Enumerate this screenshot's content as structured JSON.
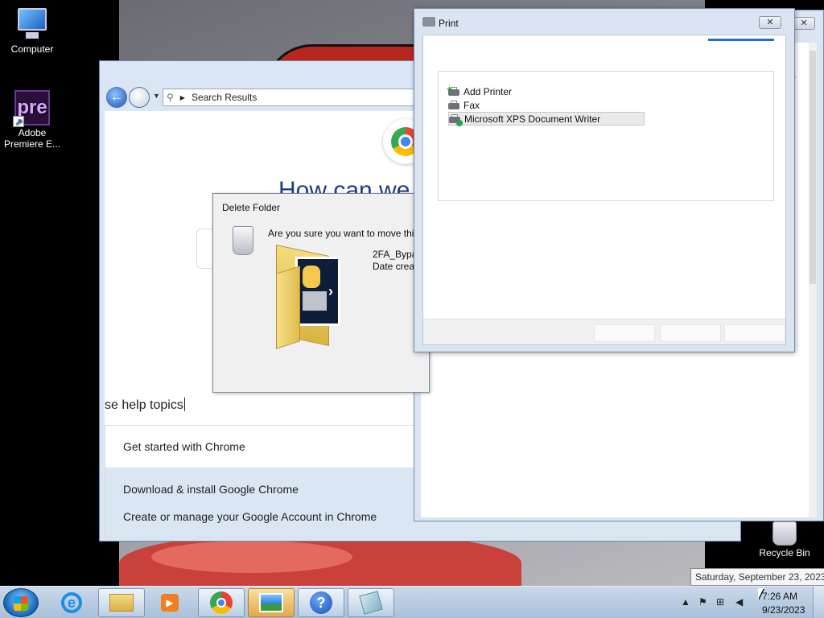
{
  "desktop": {
    "icons": [
      {
        "label": "Computer"
      },
      {
        "label": "Adobe Premiere E..."
      },
      {
        "label": "Recycle Bin"
      }
    ]
  },
  "help_window": {
    "address": "Search Results",
    "heading": "How can we",
    "search_text": "se help topics",
    "topic_header": "Get started with Chrome",
    "topics": [
      "Download & install Google Chrome",
      "Create or manage your Google Account in Chrome"
    ]
  },
  "delete_dialog": {
    "title": "Delete Folder",
    "question": "Are you sure you want to move thi",
    "file_name": "2FA_Bypa",
    "file_date": "Date creat"
  },
  "print_window": {
    "title": "Print",
    "printers": [
      "Add Printer",
      "Fax",
      "Microsoft XPS Document Writer"
    ],
    "selected_printer": "Microsoft XPS Document Writer"
  },
  "taskbar": {
    "clock_time": "7:26 AM",
    "clock_date": "9/23/2023",
    "date_tooltip": "Saturday, September 23, 2023"
  },
  "colors": {
    "help_heading": "#1a3c8c",
    "chrome_blue": "#1a73e8",
    "window_frame": "#dbe5f1"
  }
}
